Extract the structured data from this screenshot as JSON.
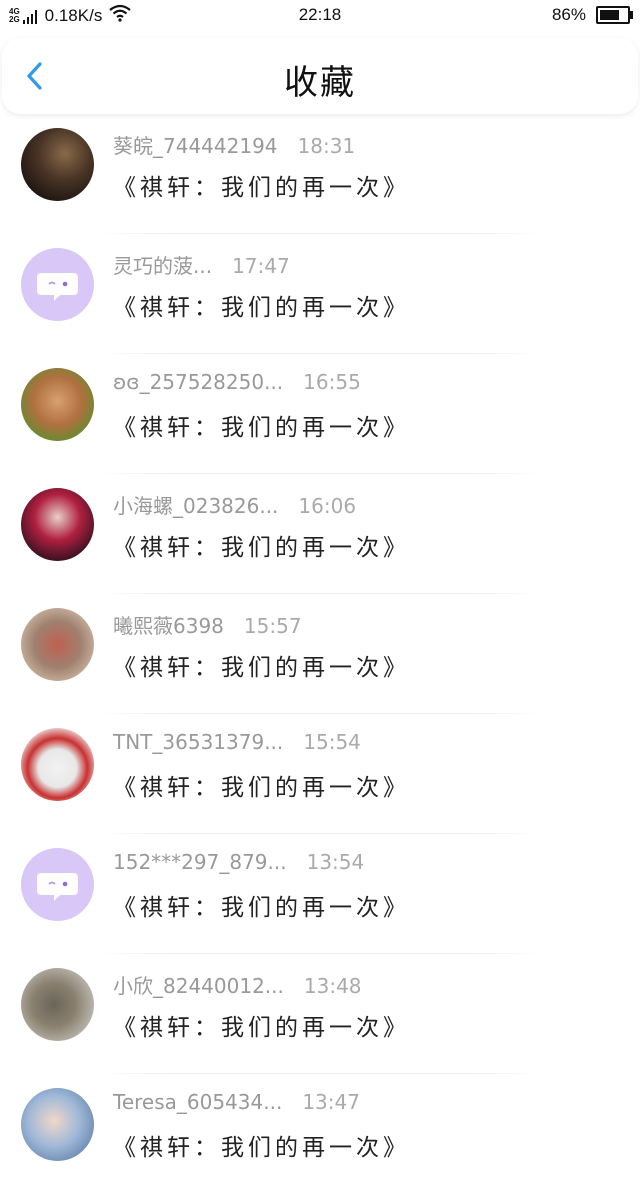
{
  "status_bar": {
    "network": "4G\n2G",
    "speed": "0.18K/s",
    "time": "22:18",
    "battery_percent": "86%",
    "battery_level": 0.86
  },
  "header": {
    "title": "收藏",
    "back_icon": "chevron-left-icon",
    "accent": "#2f9ae8"
  },
  "items": [
    {
      "name": "葵皖_744442194",
      "time": "18:31",
      "book": "《祺轩：我们的再一次》",
      "avatar": "photo"
    },
    {
      "name": "灵巧的菠...",
      "time": "17:47",
      "book": "《祺轩：我们的再一次》",
      "avatar": "default-chat-icon"
    },
    {
      "name": "ʚɞ_257528250...",
      "time": "16:55",
      "book": "《祺轩：我们的再一次》",
      "avatar": "photo"
    },
    {
      "name": "小海螺_023826...",
      "time": "16:06",
      "book": "《祺轩：我们的再一次》",
      "avatar": "photo"
    },
    {
      "name": "曦熙薇6398",
      "time": "15:57",
      "book": "《祺轩：我们的再一次》",
      "avatar": "photo"
    },
    {
      "name": "TNT_36531379...",
      "time": "15:54",
      "book": "《祺轩：我们的再一次》",
      "avatar": "photo"
    },
    {
      "name": "152***297_879...",
      "time": "13:54",
      "book": "《祺轩：我们的再一次》",
      "avatar": "default-chat-icon"
    },
    {
      "name": "小欣_82440012...",
      "time": "13:48",
      "book": "《祺轩：我们的再一次》",
      "avatar": "photo"
    },
    {
      "name": "Teresa_605434...",
      "time": "13:47",
      "book": "《祺轩：我们的再一次》",
      "avatar": "photo"
    }
  ],
  "colors": {
    "default_avatar": "#d9c7f7",
    "name_text": "#999999",
    "time_text": "#aaaaaa"
  }
}
